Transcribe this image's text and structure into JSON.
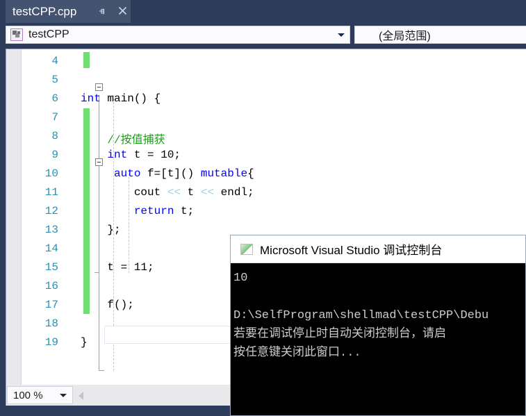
{
  "window": {
    "tab": {
      "label": "testCPP.cpp",
      "pin_icon": "pin-icon",
      "close_icon": "close-icon"
    }
  },
  "navbar": {
    "project_combo": {
      "icon": "project-icon",
      "value": "testCPP",
      "arrow_icon": "chevron-down-icon"
    },
    "scope_combo": {
      "value": "(全局范围)"
    }
  },
  "editor": {
    "lines": [
      {
        "no": "4",
        "segments": []
      },
      {
        "no": "5",
        "segments": []
      },
      {
        "no": "6",
        "segments": [
          {
            "t": "int",
            "c": "kw"
          },
          {
            "t": " main() {",
            "c": ""
          }
        ]
      },
      {
        "no": "7",
        "segments": []
      },
      {
        "no": "8",
        "segments": [
          {
            "t": "    //按值捕获",
            "c": "com"
          }
        ]
      },
      {
        "no": "9",
        "segments": [
          {
            "t": "    ",
            "c": ""
          },
          {
            "t": "int",
            "c": "kw"
          },
          {
            "t": " t = 10;",
            "c": ""
          }
        ]
      },
      {
        "no": "10",
        "segments": [
          {
            "t": "     ",
            "c": ""
          },
          {
            "t": "auto",
            "c": "kw"
          },
          {
            "t": " f=[t]() ",
            "c": ""
          },
          {
            "t": "mutable",
            "c": "kw"
          },
          {
            "t": "{",
            "c": ""
          }
        ]
      },
      {
        "no": "11",
        "segments": [
          {
            "t": "        cout ",
            "c": ""
          },
          {
            "t": "<<",
            "c": "op"
          },
          {
            "t": " t ",
            "c": ""
          },
          {
            "t": "<<",
            "c": "op"
          },
          {
            "t": " endl;",
            "c": ""
          }
        ]
      },
      {
        "no": "12",
        "segments": [
          {
            "t": "        ",
            "c": ""
          },
          {
            "t": "return",
            "c": "kw"
          },
          {
            "t": " t;",
            "c": ""
          }
        ]
      },
      {
        "no": "13",
        "segments": [
          {
            "t": "    };",
            "c": ""
          }
        ]
      },
      {
        "no": "14",
        "segments": []
      },
      {
        "no": "15",
        "segments": [
          {
            "t": "    t = 11;",
            "c": ""
          }
        ]
      },
      {
        "no": "16",
        "segments": []
      },
      {
        "no": "17",
        "segments": [
          {
            "t": "    f();",
            "c": ""
          }
        ]
      },
      {
        "no": "18",
        "segments": []
      },
      {
        "no": "19",
        "segments": [
          {
            "t": "}",
            "c": ""
          }
        ]
      }
    ],
    "fold_boxes": [
      {
        "name": "fold-toggle-main",
        "line": 2
      },
      {
        "name": "fold-toggle-lambda",
        "line": 6
      }
    ],
    "change_bars": [
      {
        "line_start": 0,
        "line_count": 1
      },
      {
        "line_start": 3,
        "line_count": 11
      }
    ],
    "current_line_index": 13
  },
  "statusbar": {
    "zoom_value": "100 %",
    "zoom_arrow_icon": "chevron-down-icon",
    "scroll_left_icon": "scroll-left-arrow-icon"
  },
  "console": {
    "title": "Microsoft Visual Studio 调试控制台",
    "icon": "console-app-icon",
    "lines": [
      "10",
      "",
      "D:\\SelfProgram\\shellmad\\testCPP\\Debu",
      "若要在调试停止时自动关闭控制台，请启",
      "按任意键关闭此窗口..."
    ]
  },
  "colors": {
    "chrome": "#2d3c5a",
    "tab_active": "#44536f",
    "keyword": "#0000ff",
    "comment": "#1f9d1f",
    "linenumber": "#2b91af",
    "changebar_green": "#6fe06f",
    "console_bg": "#000000",
    "console_fg": "#cccccc"
  }
}
